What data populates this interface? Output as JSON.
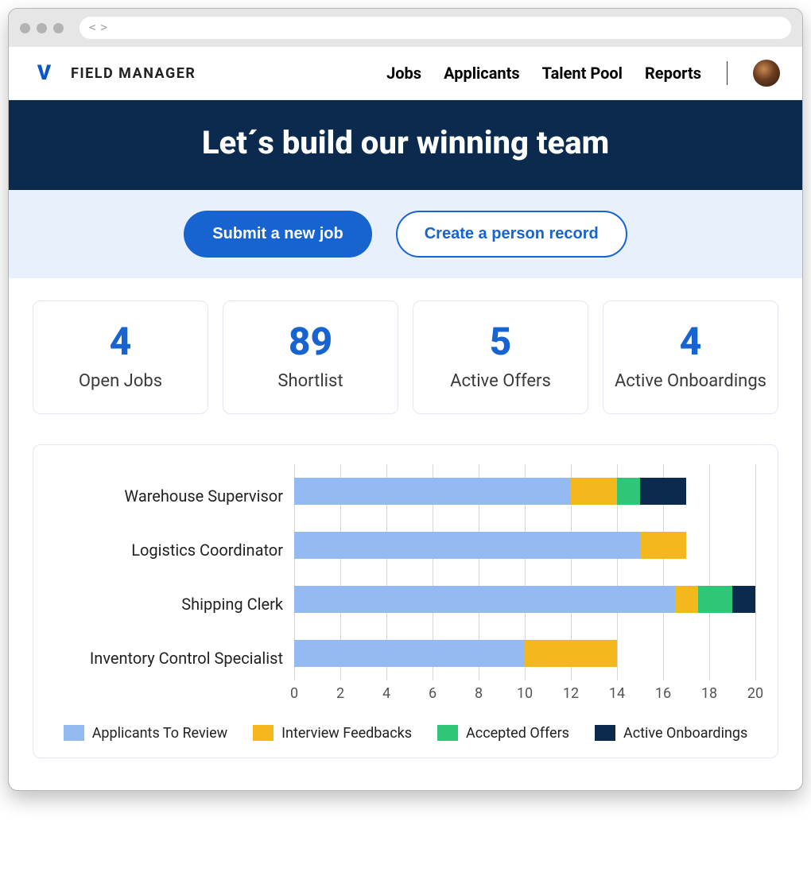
{
  "header": {
    "app_title": "FIELD MANAGER",
    "nav": [
      "Jobs",
      "Applicants",
      "Talent Pool",
      "Reports"
    ]
  },
  "hero": {
    "title": "Let´s build our winning team"
  },
  "actions": {
    "primary": "Submit a new job",
    "secondary": "Create a person record"
  },
  "stats": [
    {
      "value": "4",
      "label": "Open Jobs"
    },
    {
      "value": "89",
      "label": "Shortlist"
    },
    {
      "value": "5",
      "label": "Active Offers"
    },
    {
      "value": "4",
      "label": "Active Onboardings"
    }
  ],
  "chart_data": {
    "type": "bar",
    "orientation": "horizontal",
    "stacked": true,
    "categories": [
      "Warehouse Supervisor",
      "Logistics Coordinator",
      "Shipping Clerk",
      "Inventory Control Specialist"
    ],
    "series": [
      {
        "name": "Applicants To Review",
        "color": "#93bbf2",
        "values": [
          12.0,
          15.0,
          16.5,
          10.0
        ]
      },
      {
        "name": "Interview Feedbacks",
        "color": "#f3b81e",
        "values": [
          2.0,
          2.0,
          1.0,
          4.0
        ]
      },
      {
        "name": "Accepted Offers",
        "color": "#2fc777",
        "values": [
          1.0,
          0.0,
          1.5,
          0.0
        ]
      },
      {
        "name": "Active Onboardings",
        "color": "#0c2a4e",
        "values": [
          2.0,
          0.0,
          1.0,
          0.0
        ]
      }
    ],
    "xlim": [
      0,
      20
    ],
    "x_ticks": [
      0,
      2,
      4,
      6,
      8,
      10,
      12,
      14,
      16,
      18,
      20
    ],
    "xlabel": "",
    "ylabel": ""
  }
}
